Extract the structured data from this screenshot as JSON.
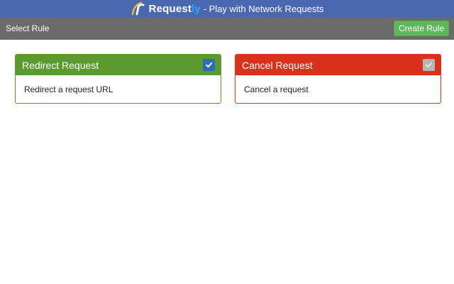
{
  "header": {
    "brand": "Request",
    "brand_accent": "ly",
    "tagline": "- Play with Network Requests"
  },
  "toolbar": {
    "title": "Select Rule",
    "create_label": "Create Rule"
  },
  "rules": [
    {
      "title": "Redirect Request",
      "description": "Redirect a request URL",
      "selected": true,
      "color": "#5a9a2e"
    },
    {
      "title": "Cancel Request",
      "description": "Cancel a request",
      "selected": false,
      "color": "#d8311c"
    }
  ],
  "colors": {
    "header_bg": "#4a68b0",
    "toolbar_bg": "#6b6b6b",
    "create_button": "#5cb85c"
  }
}
